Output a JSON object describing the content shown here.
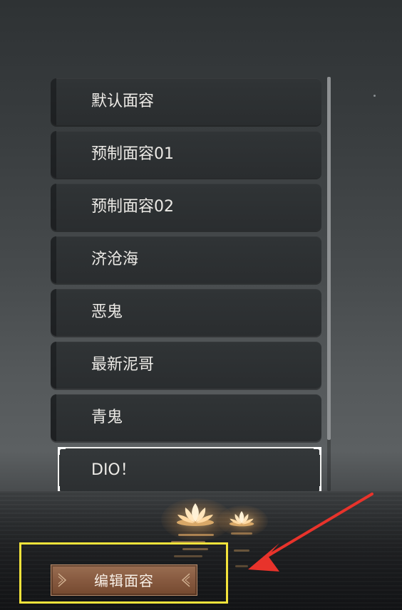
{
  "face_list": {
    "items": [
      {
        "label": "默认面容"
      },
      {
        "label": "预制面容01"
      },
      {
        "label": "预制面容02"
      },
      {
        "label": "济沧海"
      },
      {
        "label": "恶鬼"
      },
      {
        "label": "最新泥哥"
      },
      {
        "label": "青鬼"
      },
      {
        "label": "DIO！"
      }
    ],
    "selected_index": 7
  },
  "edit_button": {
    "label": "编辑面容"
  },
  "annotation": {
    "highlight_color": "#f3e33b",
    "arrow_color": "#e8332b"
  },
  "icons": {
    "lotus": "lotus-lantern-icon",
    "ornament": "button-ornament-icon"
  }
}
